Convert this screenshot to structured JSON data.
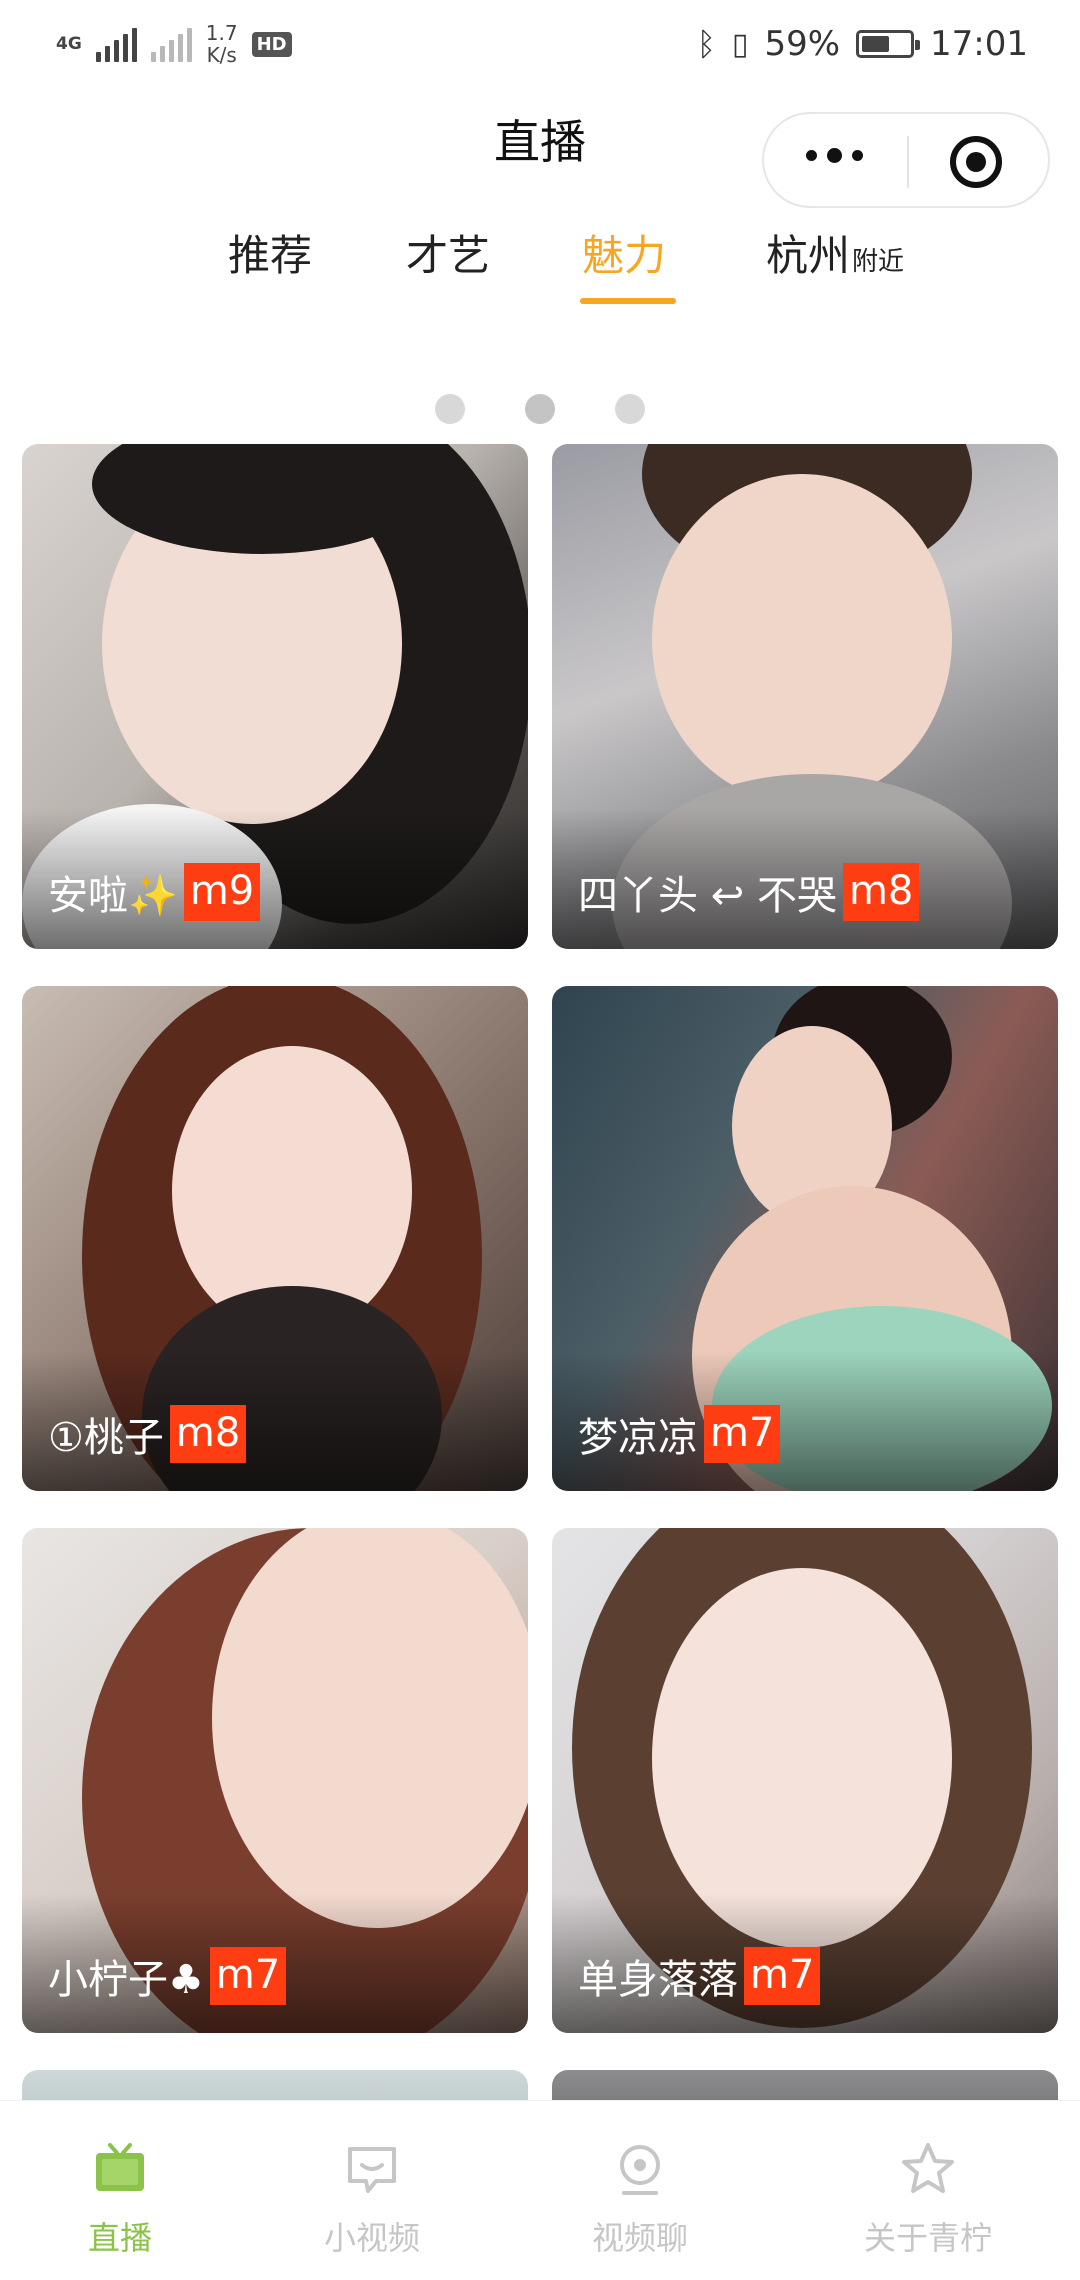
{
  "status_bar": {
    "network_label": "4G",
    "speed_value": "1.7",
    "speed_unit": "K/s",
    "hd_label": "HD",
    "battery_percent": "59%",
    "battery_level": 0.59,
    "time": "17:01"
  },
  "header": {
    "title": "直播"
  },
  "tabs": [
    {
      "label": "推荐",
      "sub": ""
    },
    {
      "label": "才艺",
      "sub": ""
    },
    {
      "label": "魅力",
      "sub": ""
    },
    {
      "label": "杭州",
      "sub": "附近"
    }
  ],
  "active_tab_index": 2,
  "carousel": {
    "dots": 3
  },
  "cards": [
    {
      "name": "安啦✨",
      "level": "m9"
    },
    {
      "name": "四丫头 ↩ 不哭",
      "level": "m8"
    },
    {
      "name": "①桃子",
      "level": "m8"
    },
    {
      "name": "梦凉凉",
      "level": "m7"
    },
    {
      "name": "小柠子♣",
      "level": "m7"
    },
    {
      "name": "单身落落",
      "level": "m7"
    }
  ],
  "bottom_nav": [
    {
      "label": "直播",
      "icon": "tv-icon",
      "active": true
    },
    {
      "label": "小视频",
      "icon": "chat-bubble-icon",
      "active": false
    },
    {
      "label": "视频聊",
      "icon": "webcam-icon",
      "active": false
    },
    {
      "label": "关于青柠",
      "icon": "star-icon",
      "active": false
    }
  ],
  "colors": {
    "accent": "#f5a623",
    "badge": "#ff3d12",
    "nav_active": "#8bc34a",
    "nav_inactive": "#c6c6c6"
  }
}
